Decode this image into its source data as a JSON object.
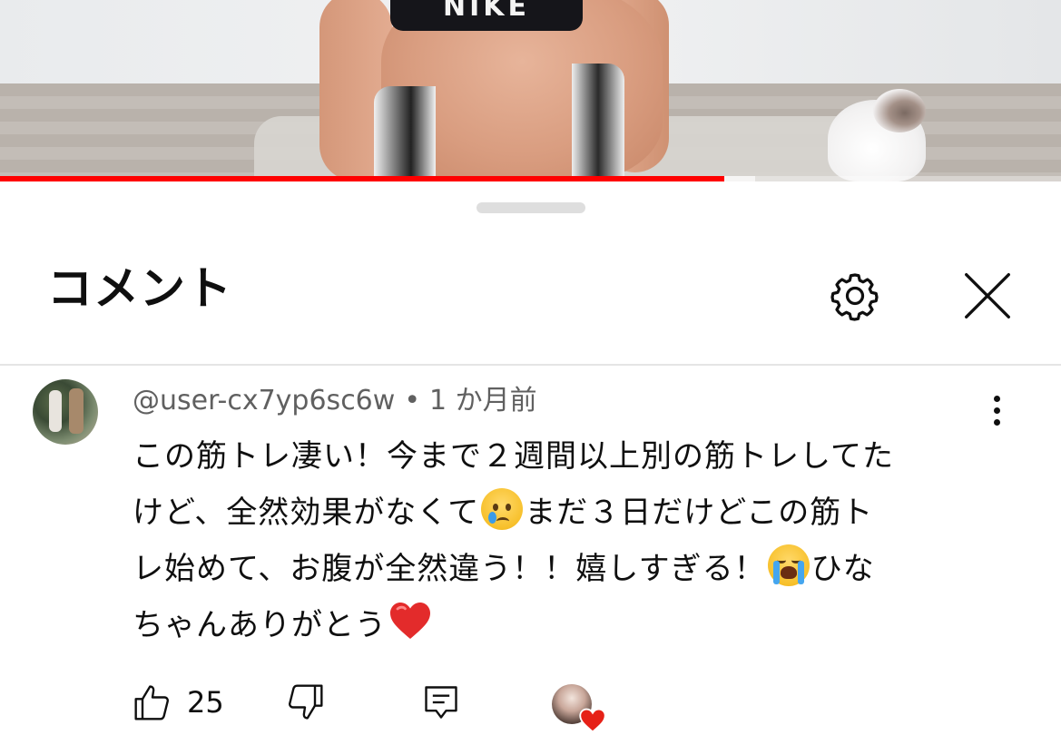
{
  "video": {
    "shirt_text": "NIKE",
    "progress_fraction": 0.683,
    "buffer_fraction": 0.712,
    "progress_color": "#ff0000"
  },
  "sheet": {
    "title": "コメント",
    "settings_icon": "gear-icon",
    "close_icon": "close-icon"
  },
  "comment": {
    "author": "@user-cx7yp6sc6w",
    "separator": "•",
    "time": "1 か月前",
    "lines": [
      "この筋トレ凄い！今まで２週間以上別の筋トレしてた",
      "けど、全然効果がなくて",
      "まだ３日だけどこの筋ト",
      "レ始めて、お腹が全然違う！！嬉しすぎる！",
      "ひな",
      "ちゃんありがとう"
    ],
    "emoji": [
      "crying-face",
      "loudly-crying-face",
      "red-heart"
    ],
    "like_count": "25",
    "like_icon": "thumbs-up-icon",
    "dislike_icon": "thumbs-down-icon",
    "reply_icon": "reply-icon",
    "creator_heart_icon": "creator-heart-icon",
    "heart_color": "#e62117"
  }
}
